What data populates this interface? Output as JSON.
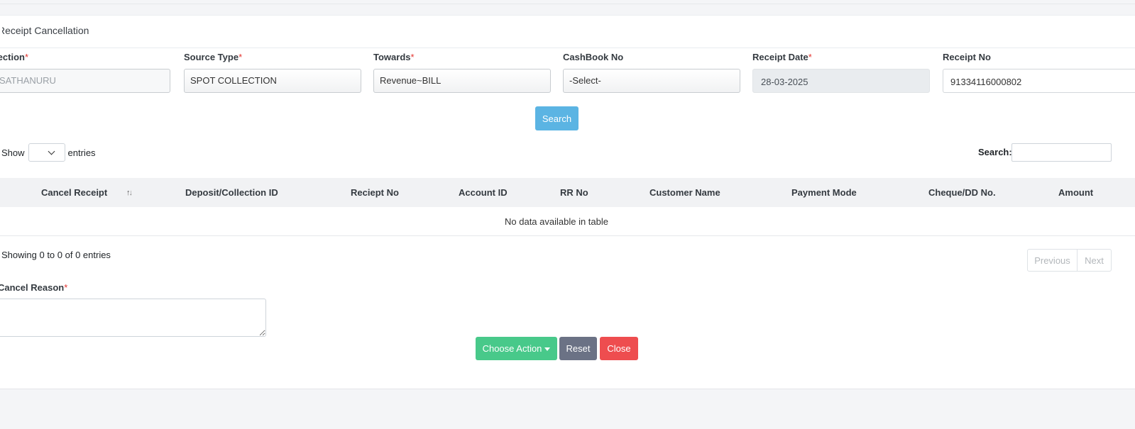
{
  "page": {
    "title": "Receipt Cancellation"
  },
  "form": {
    "section": {
      "label": "Section",
      "value": "SATHANURU"
    },
    "source_type": {
      "label": "Source Type",
      "value": "SPOT COLLECTION"
    },
    "towards": {
      "label": "Towards",
      "value": "Revenue~BILL"
    },
    "cashbook_no": {
      "label": "CashBook No",
      "value": "-Select-"
    },
    "receipt_date": {
      "label": "Receipt Date",
      "value": "28-03-2025"
    },
    "receipt_no": {
      "label": "Receipt No",
      "value": "91334116000802"
    },
    "required_mark": "*",
    "search_button": "Search"
  },
  "table_controls": {
    "show_label": "Show",
    "entries_label": "entries",
    "search_label": "Search:"
  },
  "table": {
    "columns": [
      "Cancel Receipt",
      "Deposit/Collection ID",
      "Reciept No",
      "Account ID",
      "RR No",
      "Customer Name",
      "Payment Mode",
      "Cheque/DD No.",
      "Amount"
    ],
    "sort_icon": "sort-both-icon",
    "empty_message": "No data available in table"
  },
  "pagination": {
    "info": "Showing 0 to 0 of 0 entries",
    "previous": "Previous",
    "next": "Next"
  },
  "cancel_reason": {
    "label": "Cancel Reason"
  },
  "actions": {
    "choose_action": "Choose Action",
    "reset": "Reset",
    "close": "Close"
  },
  "colors": {
    "search_button": "#5bb4e3",
    "choose_action": "#48c98a",
    "reset": "#6b7285",
    "close": "#ee4d4f",
    "required": "#e3342f"
  }
}
